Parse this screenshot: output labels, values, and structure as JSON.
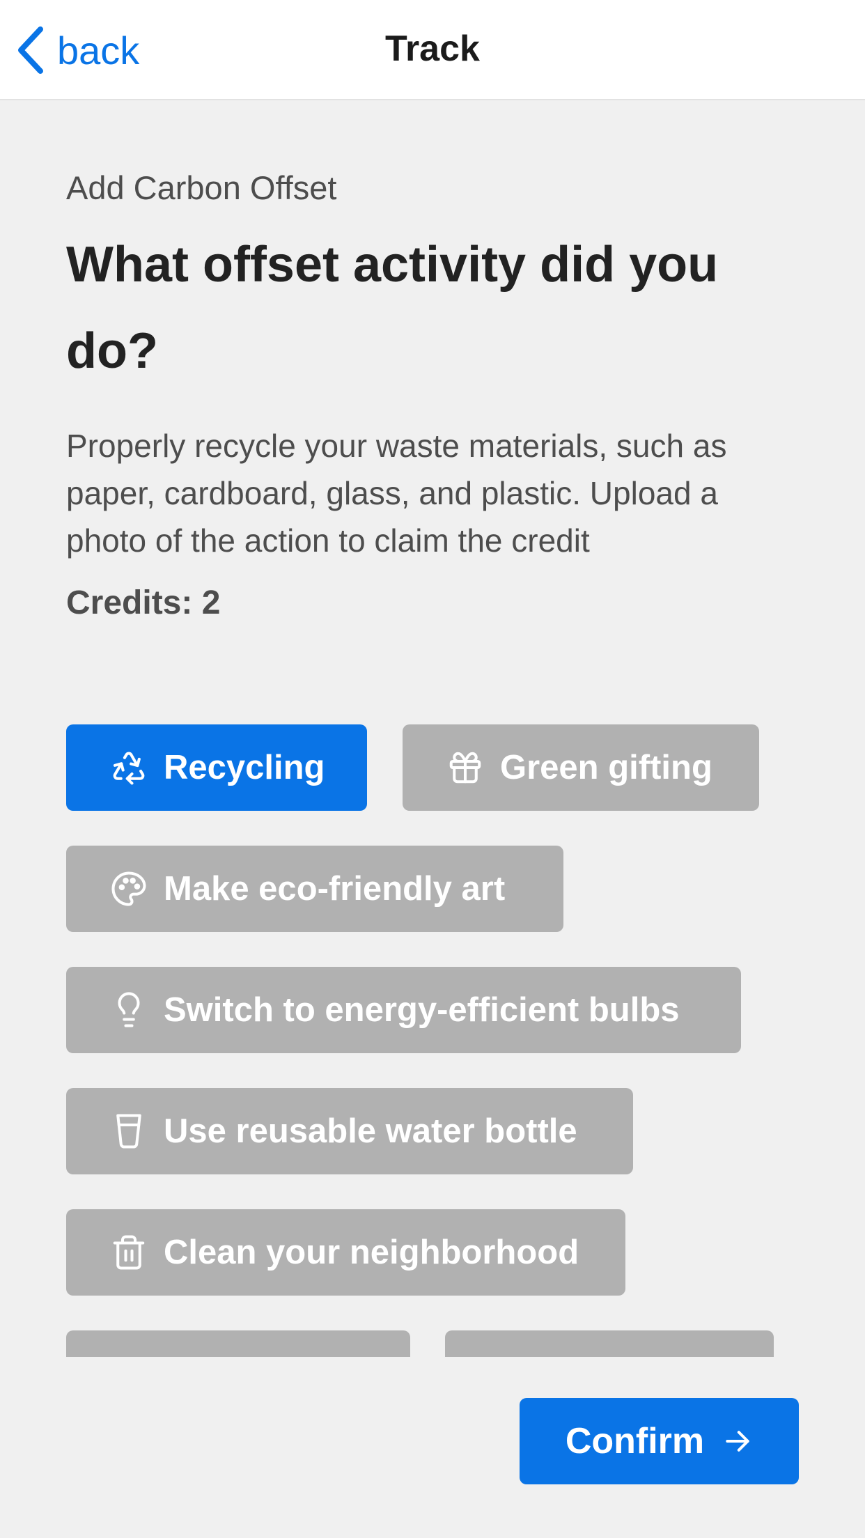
{
  "nav": {
    "back_label": "back",
    "title": "Track"
  },
  "main": {
    "eyebrow": "Add Carbon Offset",
    "heading": "What offset activity did you do?",
    "description": "Properly recycle your waste materials, such as paper, cardboard, glass, and plastic. Upload a photo of the action to claim the credit",
    "credits": "Credits: 2"
  },
  "options": [
    {
      "label": "Recycling",
      "icon": "recycle-icon",
      "selected": true
    },
    {
      "label": "Green gifting",
      "icon": "gift-icon",
      "selected": false
    },
    {
      "label": "Make eco-friendly art",
      "icon": "palette-icon",
      "selected": false
    },
    {
      "label": "Switch to energy-efficient bulbs",
      "icon": "lightbulb-icon",
      "selected": false
    },
    {
      "label": "Use reusable water bottle",
      "icon": "cup-icon",
      "selected": false
    },
    {
      "label": "Clean your neighborhood",
      "icon": "trash-icon",
      "selected": false
    }
  ],
  "footer": {
    "confirm_label": "Confirm"
  },
  "colors": {
    "accent": "#0a74e6",
    "chip_inactive": "#b1b1b1",
    "background": "#f0f0f0"
  }
}
